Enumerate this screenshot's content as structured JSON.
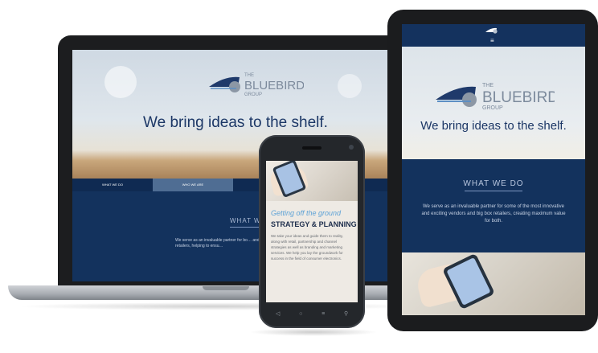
{
  "brand": {
    "the": "THE",
    "name": "BLUEBIRD",
    "group": "GROUP",
    "accent_color": "#1f3a6b",
    "logo_icon": "bluebird-logo-icon"
  },
  "laptop": {
    "tagline": "We bring ideas to the shelf.",
    "nav": [
      {
        "label": "WHAT WE DO",
        "active": false
      },
      {
        "label": "WHO WE ARE",
        "active": true
      }
    ],
    "section_heading": "WHAT WE",
    "body_text": "We serve as an invaluable partner for bo… and big box retailers, helping to ensu…"
  },
  "tablet": {
    "menu_icon": "hamburger-menu-icon",
    "tagline": "We bring ideas to the shelf.",
    "section_heading": "WHAT WE DO",
    "body_text": "We serve as an invaluable partner for some of the most innovative and exciting vendors and big box retailers, creating maximum value for both."
  },
  "phone": {
    "subheading": "Getting off the ground",
    "heading": "STRATEGY & PLANNING",
    "body_text": "We take your ideas and guide them to reality, along with retail, partnership and channel strategies as well as branding and marketing services. We help you lay the groundwork for success in the field of consumer electronics.",
    "nav_keys": [
      "back-icon",
      "home-icon",
      "menu-icon",
      "search-icon"
    ]
  },
  "colors": {
    "navy": "#13325d",
    "nav_active": "#4f6d93",
    "phone_accent": "#5da2d6"
  }
}
